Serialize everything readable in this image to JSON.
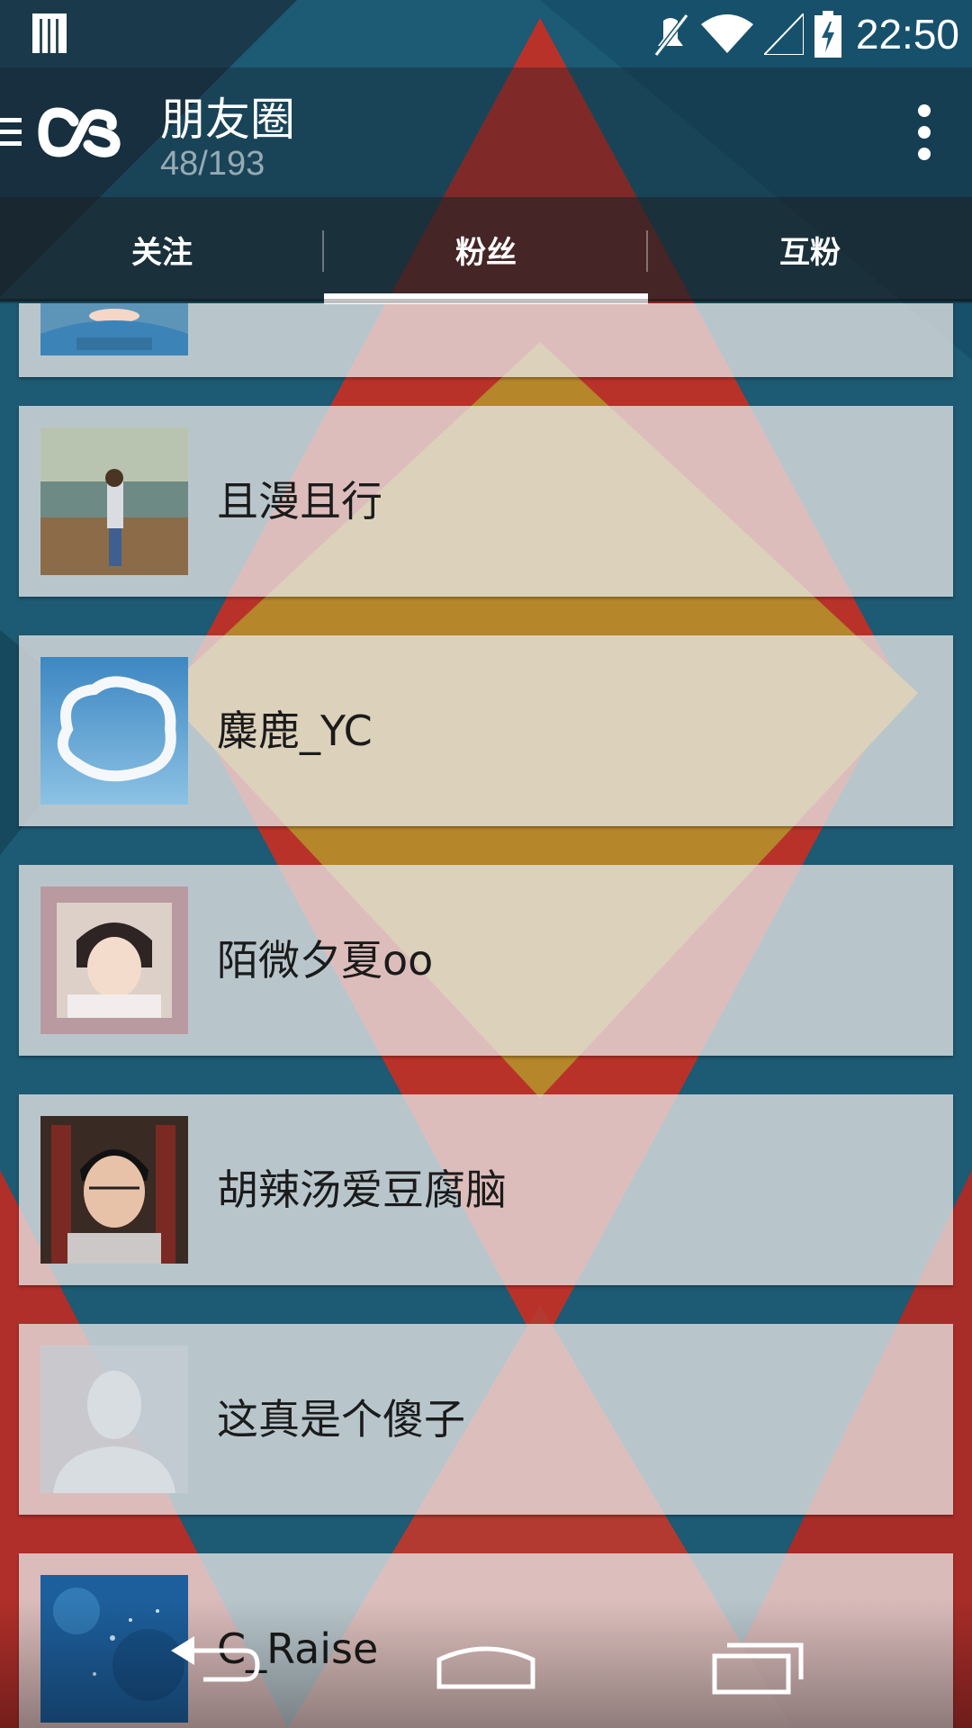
{
  "status_bar": {
    "time": "22:50",
    "icons": [
      "notification-icon",
      "mute-icon",
      "wifi-icon",
      "signal-icon",
      "battery-charging-icon"
    ]
  },
  "action_bar": {
    "title": "朋友圈",
    "subtitle": "48/193",
    "icons": [
      "hamburger-icon",
      "lastfm-logo",
      "overflow-menu-icon"
    ]
  },
  "tabs": [
    {
      "label": "关注",
      "active": false
    },
    {
      "label": "粉丝",
      "active": true
    },
    {
      "label": "互粉",
      "active": false
    }
  ],
  "list": {
    "items": [
      {
        "name": "",
        "avatar": "berlin-shirt-photo"
      },
      {
        "name": "且漫且行",
        "avatar": "beach-photo"
      },
      {
        "name": "麋鹿_YC",
        "avatar": "cloud-heart-photo"
      },
      {
        "name": "陌微夕夏oo",
        "avatar": "girl-peace-sign-photo"
      },
      {
        "name": "胡辣汤爱豆腐脑",
        "avatar": "boy-glasses-photo"
      },
      {
        "name": "这真是个傻子",
        "avatar": "default-avatar-placeholder"
      },
      {
        "name": "C_Raise",
        "avatar": "underwater-fish-photo"
      }
    ]
  },
  "nav_bar": {
    "icons": [
      "back-icon",
      "home-icon",
      "recent-apps-icon"
    ]
  },
  "colors": {
    "background_teal": "#1d5a73",
    "accent_red": "#c0382b",
    "accent_yellow": "#b8860b",
    "card_bg": "#e8e8e8",
    "indicator": "#ffffff"
  }
}
